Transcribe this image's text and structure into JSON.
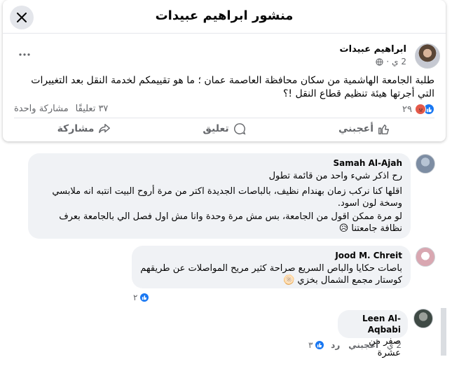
{
  "dialog": {
    "title": "منشور ابراهيم عبيدات"
  },
  "post": {
    "author": "ابراهيم عبيدات",
    "time": "2 ي",
    "separator": "·",
    "text": "طلبة الجامعة الهاشمية من سكان محافظة العاصمة عمان ؛ ما هو تقييمكم لخدمة النقل بعد التغييرات التي أجرتها هيئة تنظيم قطاع النقل !؟",
    "reactions_count": "٢٩",
    "comments": "٣٧ تعليقًا",
    "shares": "مشاركة واحدة"
  },
  "actions": {
    "like": "أعجبني",
    "comment": "تعليق",
    "share": "مشاركة"
  },
  "comments": [
    {
      "name": "Samah Al-Ajah",
      "lines": [
        "رح اذكر شيء واحد من قائمة تطول",
        "اقلها كنا نركب زمان بهندام نظيف، بالباصات الجديدة اكتر من مرة أروح البيت انتبه انه ملابسي وسخة لون اسود.",
        "لو مرة ممكن اقول من الجامعة، بس مش مرة وحدة وانا مش اول فصل الي بالجامعة بعرف نظافة جامعتنا 😥"
      ]
    },
    {
      "name": "Jood M. Chreit",
      "lines": [
        "باصات حكايا والباص السريع صراحة كثير مريح المواصلات عن طريقهم كوستار مجمع الشمال بخزي 🫓"
      ],
      "reply_count": "٢"
    },
    {
      "name": "Leen Al-Aqbabi",
      "lines": [
        "صفر من عشرة"
      ],
      "time": "2 ي",
      "like": "أعجبني",
      "reply": "رد",
      "reply_count": "٣"
    }
  ],
  "colors": {
    "accent": "#1877f2",
    "secondary_text": "#65676b",
    "bubble": "#f0f2f5"
  }
}
